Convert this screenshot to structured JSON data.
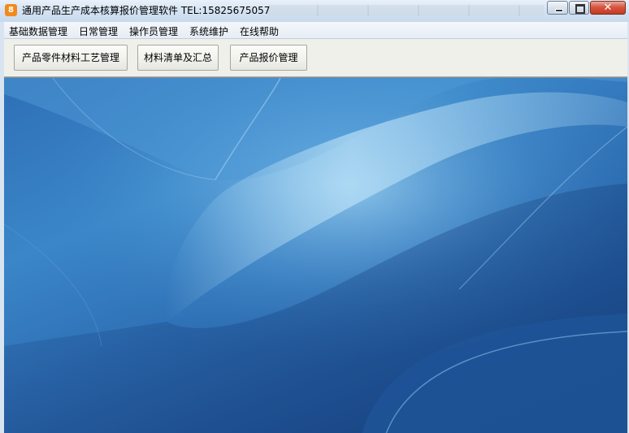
{
  "window": {
    "title": "通用产品生产成本核算报价管理软件 TEL:15825675057",
    "app_icon_glyph": "8",
    "close_glyph": "✕"
  },
  "menu": {
    "items": [
      {
        "label": "基础数据管理"
      },
      {
        "label": "日常管理"
      },
      {
        "label": "操作员管理"
      },
      {
        "label": "系统维护"
      },
      {
        "label": "在线帮助"
      }
    ]
  },
  "toolbar": {
    "buttons": [
      {
        "label": "产品零件材料工艺管理"
      },
      {
        "label": "材料清单及汇总"
      },
      {
        "label": "产品报价管理"
      }
    ]
  },
  "colors": {
    "desktop_base": "#2b64a8",
    "desktop_light": "#8cc6ec",
    "accent_icon": "#f28a1b"
  }
}
